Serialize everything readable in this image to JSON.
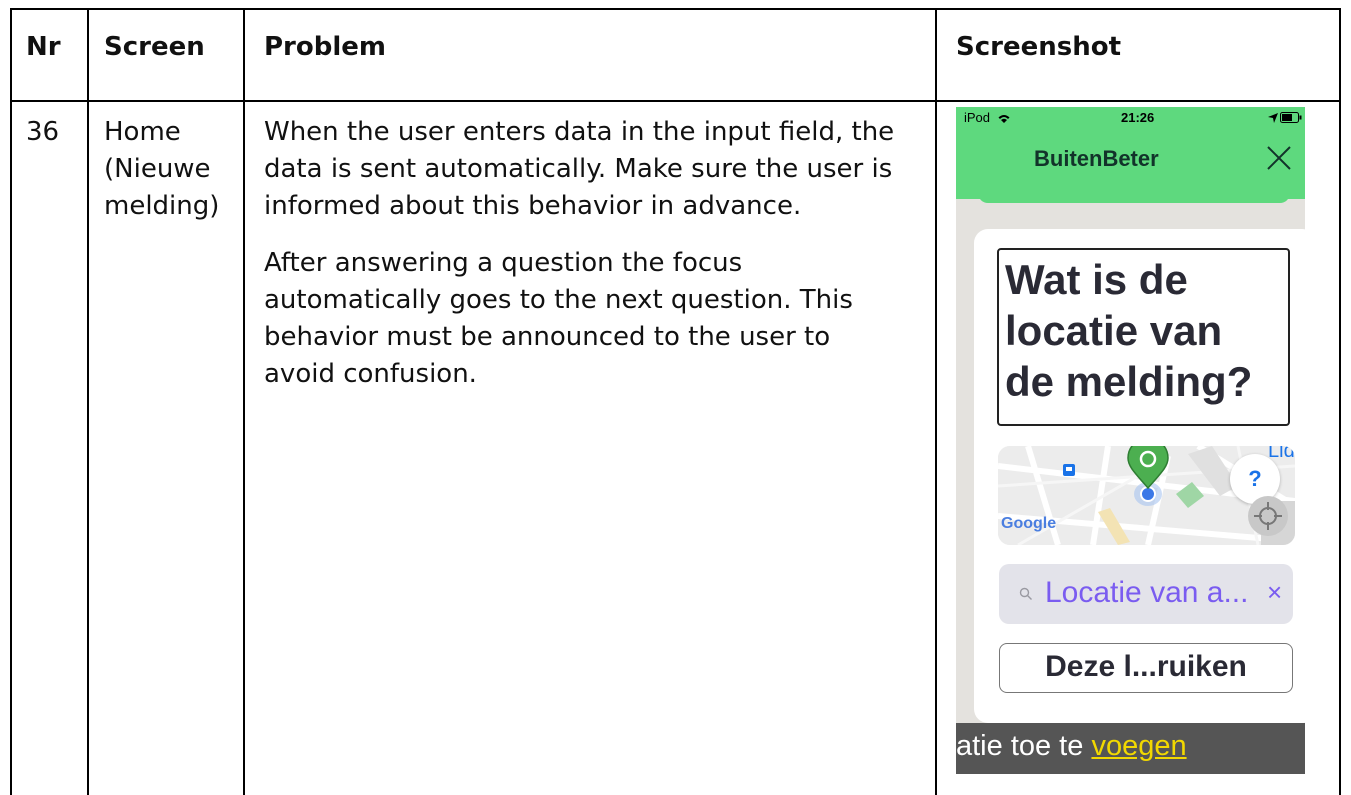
{
  "table": {
    "headers": {
      "nr": "Nr",
      "screen": "Screen",
      "problem": "Problem",
      "screenshot": "Screenshot"
    },
    "rows": [
      {
        "nr": "36",
        "screen": [
          "Home",
          "(Nieuwe",
          "melding)"
        ],
        "problem": [
          "When the user enters data in the input field, the data is sent automatically. Make sure the user is informed about this behavior in advance.",
          "After answering a question the focus automatically goes to the next question. This behavior must be announced to the user to avoid confusion."
        ]
      }
    ]
  },
  "phone": {
    "status": {
      "carrier": "iPod",
      "time": "21:26"
    },
    "app_title": "BuitenBeter",
    "question": "Wat is de locatie van de melding?",
    "map": {
      "brand": "Google",
      "poi": "Lidl",
      "help": "?"
    },
    "search": {
      "value": "Locatie van a...",
      "clear": "×"
    },
    "use_button": "Deze l...ruiken",
    "caption": {
      "prefix": "atie toe te ",
      "link": "voegen"
    },
    "colors": {
      "appbar": "#5ed97e",
      "search_text": "#7a5cf0",
      "caption_link": "#f2d800"
    }
  }
}
